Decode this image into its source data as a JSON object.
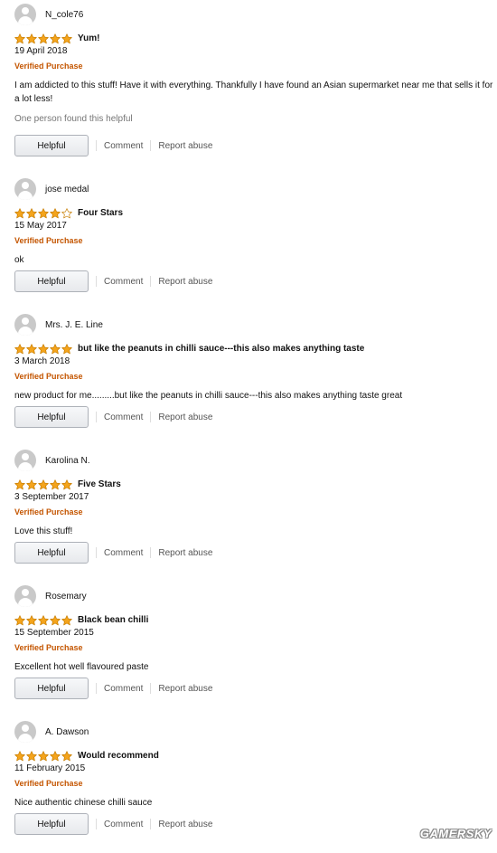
{
  "colors": {
    "star_filled": "#f4a41c",
    "star_empty": "#ffffff",
    "star_outline": "#c77d00",
    "verified": "#c45500",
    "helpful_note": "#767676"
  },
  "reviews": [
    {
      "reviewer": "N_cole76",
      "rating": 5,
      "title": "Yum!",
      "date": "19 April 2018",
      "verified": "Verified Purchase",
      "text": "I am addicted to this stuff! Have it with everything. Thankfully I have found an Asian supermarket near me that sells it for a lot less!",
      "helpful_note": "One person found this helpful",
      "helpful_label": "Helpful",
      "comment_label": "Comment",
      "report_label": "Report abuse"
    },
    {
      "reviewer": "jose medal",
      "rating": 4,
      "title": "Four Stars",
      "date": "15 May 2017",
      "verified": "Verified Purchase",
      "text": "ok",
      "helpful_label": "Helpful",
      "comment_label": "Comment",
      "report_label": "Report abuse"
    },
    {
      "reviewer": "Mrs. J. E. Line",
      "rating": 5,
      "title": "but like the peanuts in chilli sauce---this also makes anything taste",
      "date": "3 March 2018",
      "verified": "Verified Purchase",
      "text": "new product for me.........but like the peanuts in chilli sauce---this also makes anything taste great",
      "helpful_label": "Helpful",
      "comment_label": "Comment",
      "report_label": "Report abuse"
    },
    {
      "reviewer": "Karolina N.",
      "rating": 5,
      "title": "Five Stars",
      "date": "3 September 2017",
      "verified": "Verified Purchase",
      "text": "Love this stuff!",
      "helpful_label": "Helpful",
      "comment_label": "Comment",
      "report_label": "Report abuse"
    },
    {
      "reviewer": "Rosemary",
      "rating": 5,
      "title": "Black bean chilli",
      "date": "15 September 2015",
      "verified": "Verified Purchase",
      "text": "Excellent hot well flavoured paste",
      "helpful_label": "Helpful",
      "comment_label": "Comment",
      "report_label": "Report abuse"
    },
    {
      "reviewer": "A. Dawson",
      "rating": 5,
      "title": "Would recommend",
      "date": "11 February 2015",
      "verified": "Verified Purchase",
      "text": "Nice authentic chinese chilli sauce",
      "helpful_label": "Helpful",
      "comment_label": "Comment",
      "report_label": "Report abuse"
    }
  ],
  "watermark": "GAMERSKY"
}
